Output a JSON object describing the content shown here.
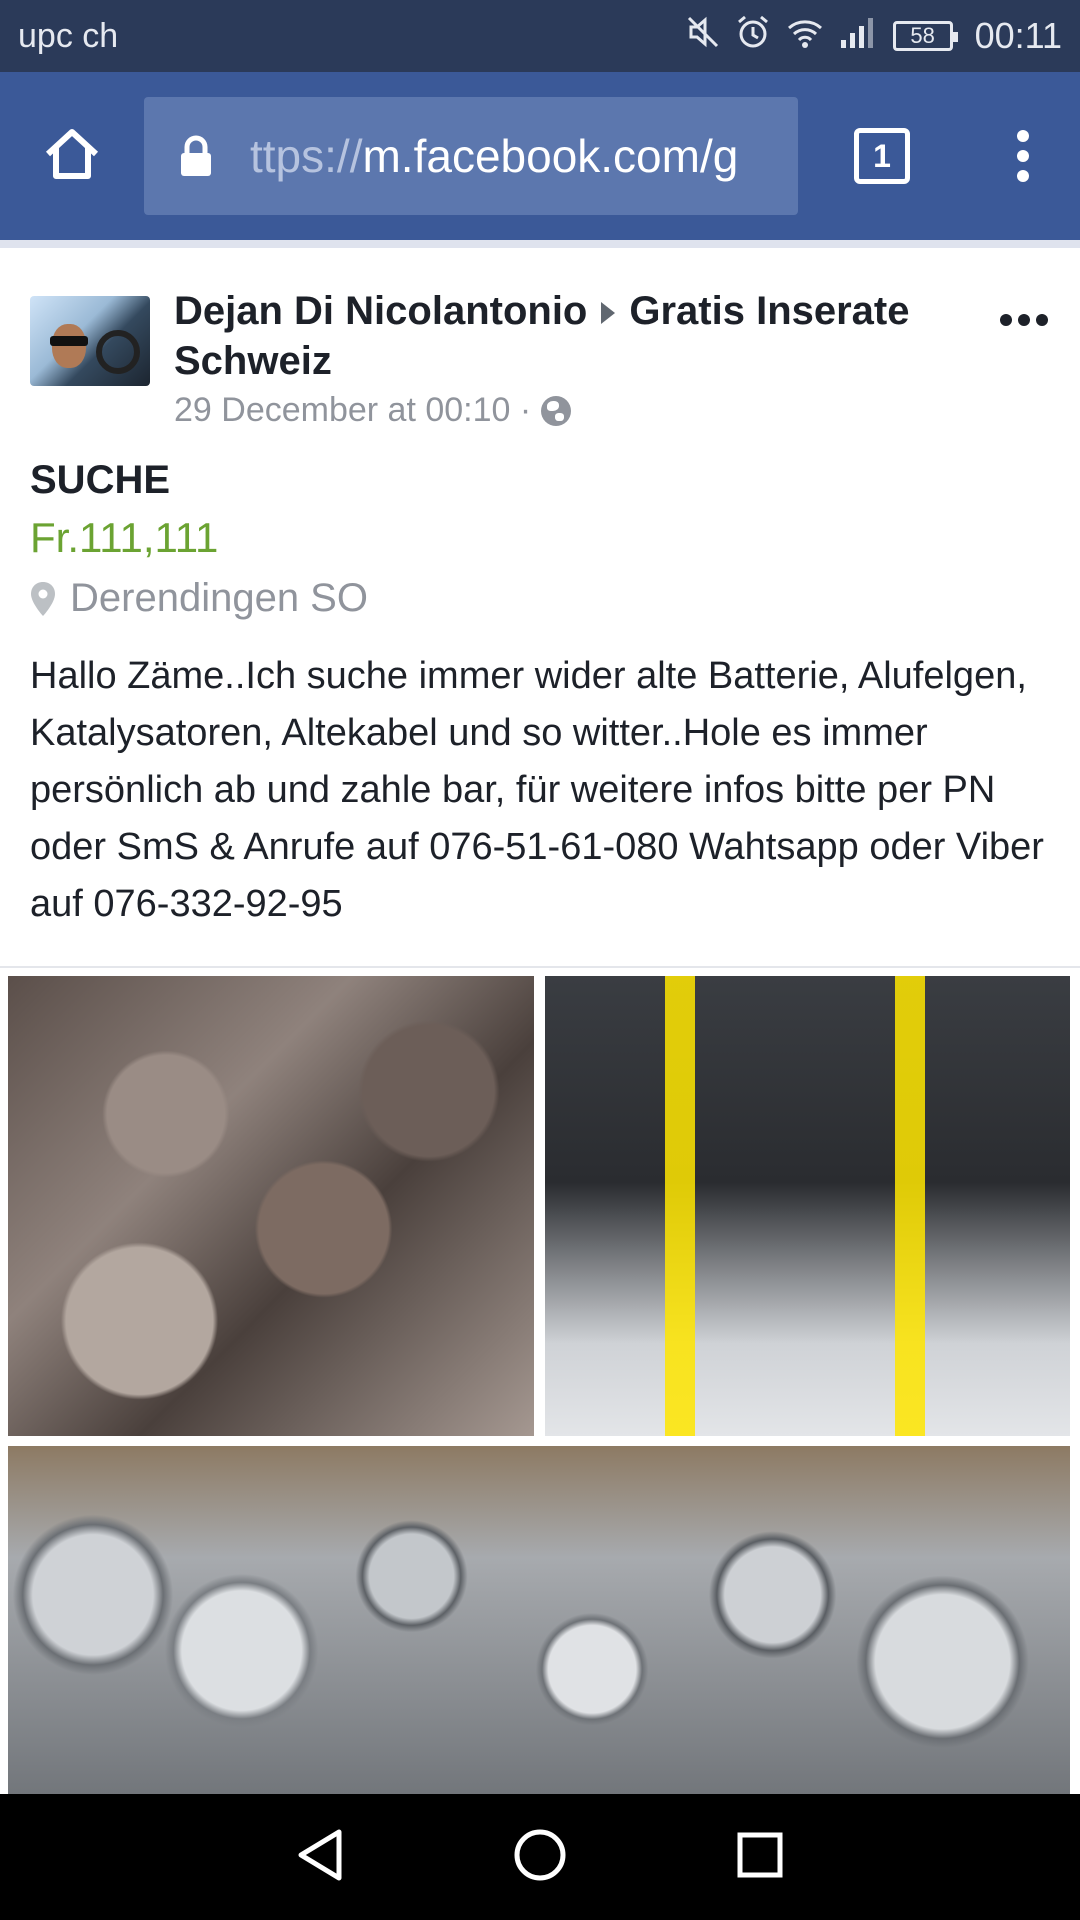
{
  "status_bar": {
    "carrier": "upc ch",
    "battery_level": "58",
    "time": "00:11",
    "icons": [
      "mute-icon",
      "alarm-icon",
      "wifi-icon",
      "signal-icon",
      "battery-icon"
    ]
  },
  "browser": {
    "url_scheme": "ttps://",
    "url_host": "m.facebook.com/g",
    "tab_count": "1",
    "icons": [
      "home-icon",
      "lock-icon",
      "tabs-icon",
      "overflow-menu-icon"
    ]
  },
  "post": {
    "author": "Dejan Di Nicolantonio",
    "group": "Gratis Inserate Schweiz",
    "timestamp": "29 December at 00:10 ·",
    "listing_title": "SUCHE",
    "price": "Fr.111,111",
    "location": "Derendingen SO",
    "body": "Hallo Zäme..Ich suche immer wider alte Batterie, Alufelgen, Katalysatoren, Altekabel und so witter..Hole es immer persönlich ab und zahle bar, für weitere infos bitte per PN oder SmS & Anrufe auf 076-51-61-080 Wahtsapp oder Viber auf 076-332-92-95"
  },
  "colors": {
    "status_bar_bg": "#2b3a59",
    "toolbar_bg": "#3b5998",
    "url_box_bg": "#5c77ae",
    "price_green": "#6ba332",
    "meta_gray": "#90949c"
  }
}
